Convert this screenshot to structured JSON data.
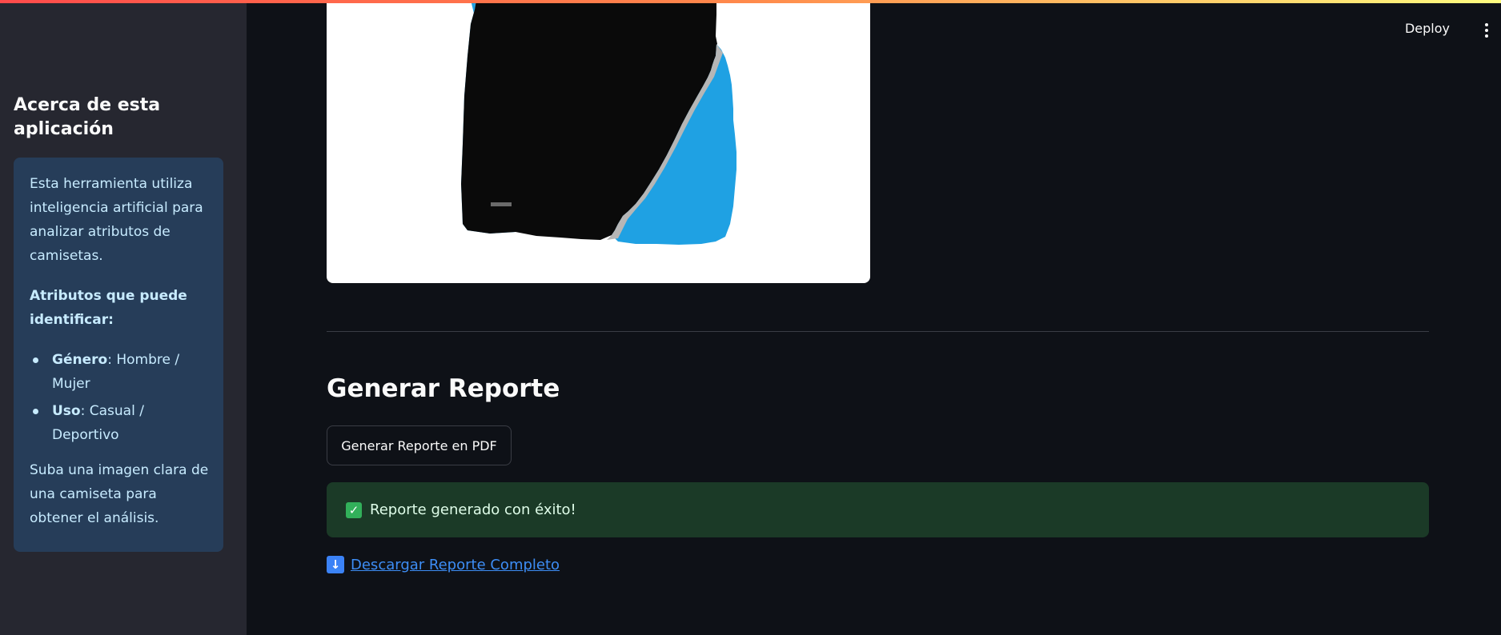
{
  "header": {
    "deploy_label": "Deploy",
    "menu_icon": "kebab-menu-icon"
  },
  "sidebar": {
    "title": "Acerca de esta aplicación",
    "intro": "Esta herramienta utiliza inteligencia artificial para analizar atributos de camisetas.",
    "attributes_heading": "Atributos que puede identificar:",
    "attributes": [
      {
        "name": "Género",
        "value": ": Hombre / Mujer"
      },
      {
        "name": "Uso",
        "value": ": Casual / Deportivo"
      }
    ],
    "footer": "Suba una imagen clara de una camiseta para obtener el análisis."
  },
  "main": {
    "report_title": "Generar Reporte",
    "generate_button": "Generar Reporte en PDF",
    "success_message": "Reporte generado con éxito!",
    "success_icon": "check-mark-icon",
    "download_link": "Descargar Reporte Completo",
    "download_icon": "down-arrow-icon"
  },
  "colors": {
    "app_background": "#0e1117",
    "sidebar_background": "#262730",
    "info_background": "#263d59",
    "success_background": "#1b3a27",
    "link": "#3d8df5"
  }
}
